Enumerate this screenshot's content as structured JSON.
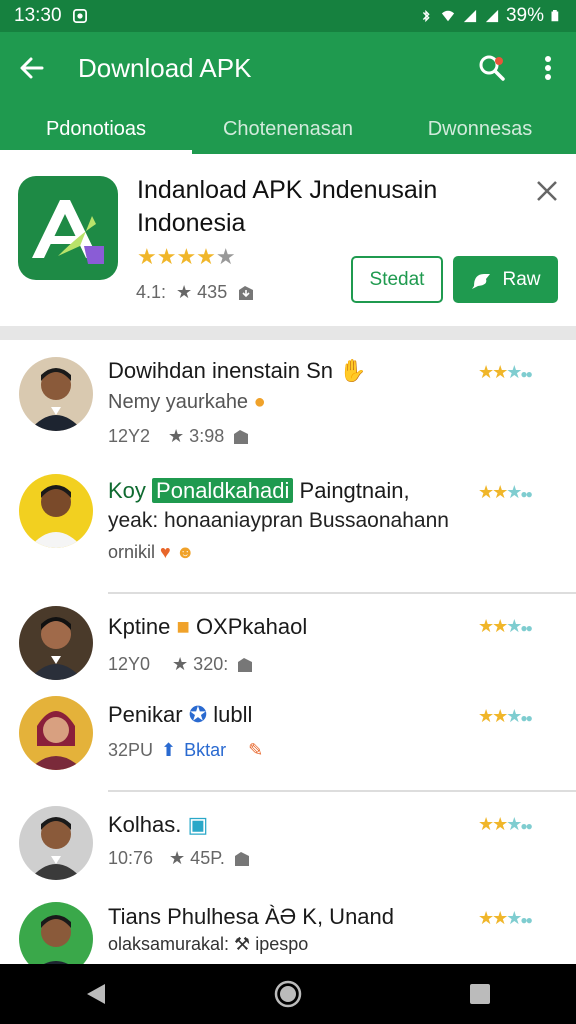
{
  "status_bar": {
    "time": "13:30",
    "battery": "39%"
  },
  "app_bar": {
    "title": "Download APK"
  },
  "tabs": [
    {
      "label": "Pdonotioas",
      "active": true
    },
    {
      "label": "Chotenenasan",
      "active": false
    },
    {
      "label": "Dwonnesas",
      "active": false
    }
  ],
  "featured": {
    "name": "Indanload APK Jndenusain Indonesia",
    "stars": "★★★★",
    "meta_left": "4.1:",
    "meta_right": "★ 435",
    "btn_outline": "Stedat",
    "btn_fill": "Raw"
  },
  "items": [
    {
      "title": "Dowihdan inenstain Sn",
      "sub": "Nemy yaurkahe",
      "meta": "12Y2",
      "meta2": "★ 3:98"
    },
    {
      "title_pre": "Koy",
      "title_hl": "Ponaldkahadi",
      "title_post": "Paingtnain,",
      "sub": "yeak: honaaniaypran Bussaonahann",
      "meta": "ornikil"
    },
    {
      "title": "Kptine",
      "title_post": "OXPkahaol",
      "meta": "12Y0",
      "meta2": "★ 320:"
    },
    {
      "title": "Penikar",
      "title_post": "lubll",
      "meta": "32PU",
      "meta2": "Bktar"
    },
    {
      "title": "Kolhas.",
      "meta": "10:76",
      "meta2": "★ 45P."
    },
    {
      "title": "Tians Phulhesa ÀƏ K, Unand",
      "sub": "olaksamurakal: ⚒ ipespo"
    }
  ],
  "colors": {
    "primary": "#1f9a4f",
    "status": "#16813f",
    "star": "#f0b62a",
    "teal_star": "#7fcdd0"
  },
  "icons": [
    "back-arrow-icon",
    "search-icon",
    "more-vert-icon",
    "close-icon",
    "download-icon",
    "back-nav-icon",
    "home-nav-icon",
    "recents-nav-icon"
  ]
}
